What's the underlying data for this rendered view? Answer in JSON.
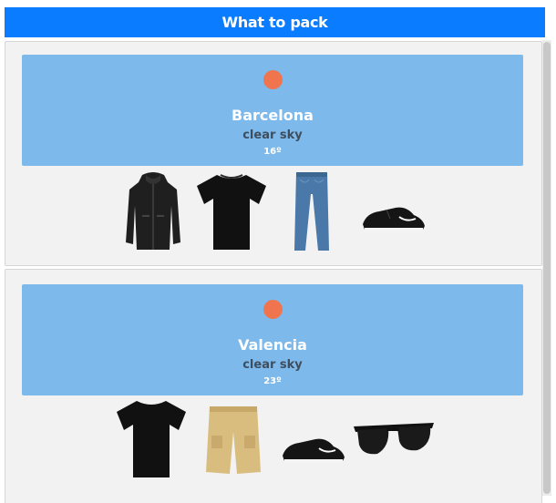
{
  "header": {
    "title": "What to pack"
  },
  "colors": {
    "header": "#0a7cff",
    "weather_box": "#7db9ea",
    "sun": "#f0754e"
  },
  "cards": [
    {
      "city": "Barcelona",
      "description": "clear sky",
      "temperature": "16º",
      "weather_icon": "sun-icon",
      "items": [
        "jacket-icon",
        "tshirt-icon",
        "jeans-icon",
        "sneakers-icon"
      ]
    },
    {
      "city": "Valencia",
      "description": "clear sky",
      "temperature": "23º",
      "weather_icon": "sun-icon",
      "items": [
        "tshirt-icon",
        "shorts-icon",
        "sneakers-icon",
        "sunglasses-icon"
      ]
    }
  ]
}
